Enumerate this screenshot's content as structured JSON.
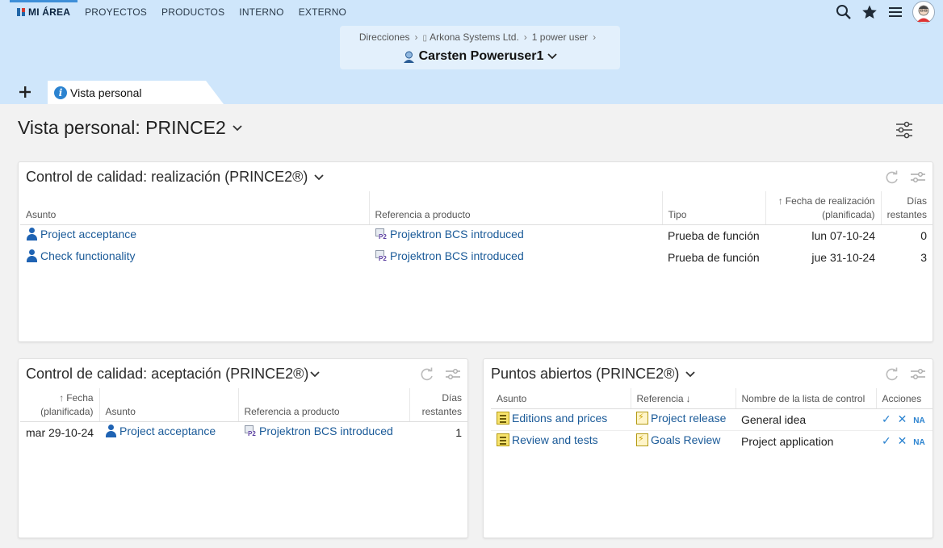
{
  "topnav": {
    "items": [
      "MI ÁREA",
      "PROYECTOS",
      "PRODUCTOS",
      "INTERNO",
      "EXTERNO"
    ]
  },
  "context": {
    "breadcrumb": [
      "Direcciones",
      "Arkona Systems Ltd.",
      "1 power user"
    ],
    "title": "Carsten Poweruser1"
  },
  "tabs": {
    "active_label": "Vista personal"
  },
  "page": {
    "title": "Vista personal: PRINCE2"
  },
  "panel_realizacion": {
    "title": "Control de calidad: realización (PRINCE2®)",
    "columns": [
      "Asunto",
      "Referencia a producto",
      "Tipo",
      "Fecha de realización",
      "(planificada)",
      "Días",
      "restantes"
    ],
    "rows": [
      {
        "asunto": "Project acceptance",
        "referencia": "Projektron BCS introduced",
        "tipo": "Prueba de función",
        "fecha": "lun 07-10-24",
        "dias": "0"
      },
      {
        "asunto": "Check functionality",
        "referencia": "Projektron BCS introduced",
        "tipo": "Prueba de función",
        "fecha": "jue 31-10-24",
        "dias": "3"
      }
    ]
  },
  "panel_aceptacion": {
    "title": "Control de calidad: aceptación (PRINCE2®)",
    "columns": [
      "Fecha",
      "(planificada)",
      "Asunto",
      "Referencia a producto",
      "Días",
      "restantes"
    ],
    "rows": [
      {
        "fecha": "mar 29-10-24",
        "asunto": "Project acceptance",
        "referencia": "Projektron BCS introduced",
        "dias": "1"
      }
    ]
  },
  "panel_puntos": {
    "title": "Puntos abiertos (PRINCE2®)",
    "columns": [
      "Asunto",
      "Referencia",
      "Nombre de la lista de control",
      "Acciones"
    ],
    "rows": [
      {
        "asunto": "Editions and prices",
        "referencia": "Project release",
        "lista": "General idea",
        "na": "NA"
      },
      {
        "asunto": "Review and tests",
        "referencia": "Goals Review",
        "lista": "Project application",
        "na": "NA"
      }
    ]
  },
  "colors": {
    "topbar": "#cfe6fb",
    "link": "#1a5a98",
    "accent": "#2b83d0"
  },
  "icons": [
    "search-icon",
    "star-icon",
    "menu-icon",
    "avatar",
    "settings-sliders-icon",
    "refresh-icon",
    "user-icon",
    "product-icon",
    "checklist-icon",
    "flash-icon",
    "check-icon",
    "close-icon"
  ]
}
